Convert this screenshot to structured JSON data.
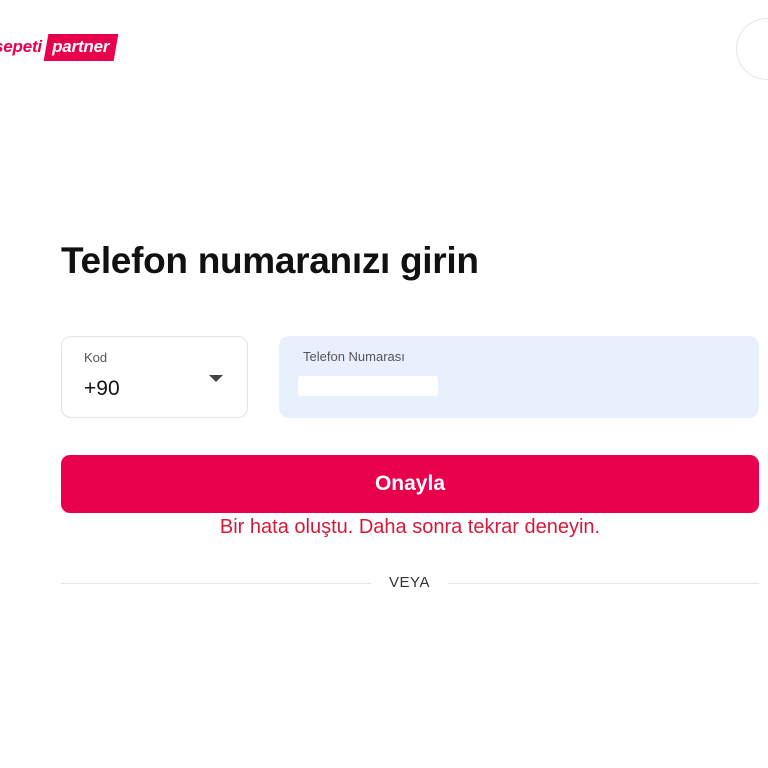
{
  "header": {
    "logo_word": "sepeti",
    "logo_badge": "partner",
    "brand_color": "#e8004c"
  },
  "form": {
    "title": "Telefon numaranızı girin",
    "code": {
      "label": "Kod",
      "value": "+90",
      "icon": "caret-down-icon"
    },
    "phone": {
      "label": "Telefon Numarası",
      "value": "",
      "value_redacted": true,
      "background_color": "#e8f0fe"
    },
    "confirm_label": "Onayla",
    "error_message": "Bir hata oluştu. Daha sonra tekrar deneyin.",
    "error_color": "#d41a3c",
    "divider_text": "VEYA"
  }
}
